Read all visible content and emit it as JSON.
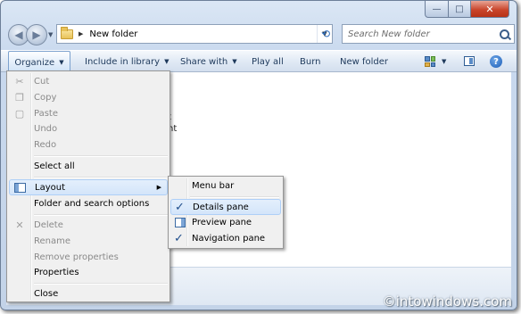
{
  "window": {
    "caption": {
      "minimize": "—",
      "maximize": "□",
      "close": "✕"
    }
  },
  "nav": {
    "back_icon": "back-arrow-icon",
    "forward_icon": "forward-arrow-icon",
    "breadcrumb_separator": "▶",
    "address": "New folder",
    "search_placeholder": "Search New folder"
  },
  "toolbar": {
    "organize": "Organize",
    "include_in_library": "Include in library",
    "share_with": "Share with",
    "play_all": "Play all",
    "burn": "Burn",
    "new_folder": "New folder",
    "help": "?"
  },
  "content": {
    "partial_text_1": "t",
    "partial_text_2": "nt"
  },
  "organize_menu": {
    "items": [
      {
        "label": "Cut",
        "enabled": false
      },
      {
        "label": "Copy",
        "enabled": false
      },
      {
        "label": "Paste",
        "enabled": false
      },
      {
        "label": "Undo",
        "enabled": false
      },
      {
        "label": "Redo",
        "enabled": false
      },
      {
        "label": "Select all",
        "enabled": true
      },
      {
        "label": "Layout",
        "enabled": true,
        "highlighted": true,
        "has_submenu": true
      },
      {
        "label": "Folder and search options",
        "enabled": true
      },
      {
        "label": "Delete",
        "enabled": false
      },
      {
        "label": "Rename",
        "enabled": false
      },
      {
        "label": "Remove properties",
        "enabled": false
      },
      {
        "label": "Properties",
        "enabled": true
      },
      {
        "label": "Close",
        "enabled": true
      }
    ]
  },
  "layout_submenu": {
    "items": [
      {
        "label": "Menu bar",
        "checked": false
      },
      {
        "label": "Details pane",
        "checked": true,
        "highlighted": true
      },
      {
        "label": "Preview pane",
        "checked": false
      },
      {
        "label": "Navigation pane",
        "checked": true
      }
    ],
    "check_glyph": "✓"
  },
  "watermark": "©intowindows.com"
}
